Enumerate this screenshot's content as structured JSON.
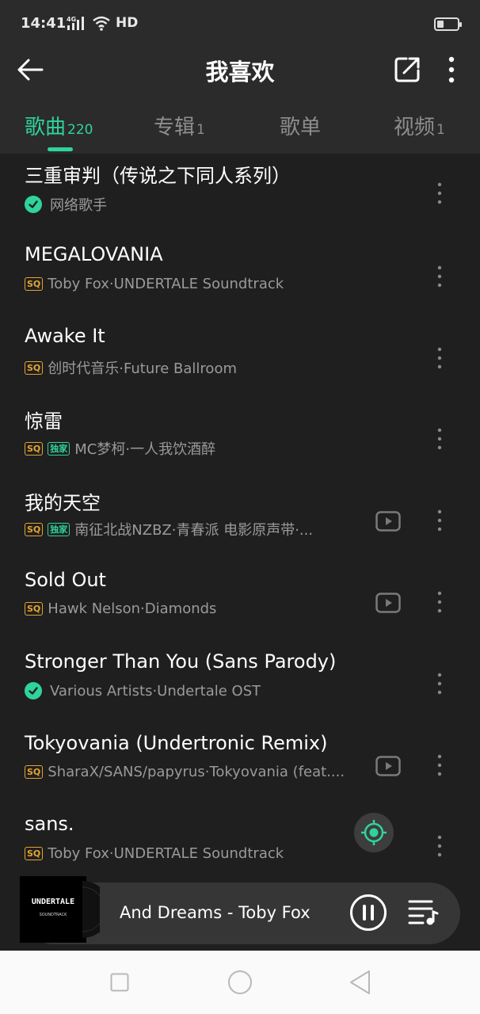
{
  "status": {
    "time": "14:41",
    "network": "4G",
    "hd": "HD"
  },
  "header": {
    "title": "我喜欢"
  },
  "tabs": [
    {
      "label": "歌曲",
      "count": "220",
      "active": true
    },
    {
      "label": "专辑",
      "count": "1"
    },
    {
      "label": "歌单",
      "count": ""
    },
    {
      "label": "视频",
      "count": "1"
    }
  ],
  "songs": [
    {
      "title": "三重审判（传说之下同人系列）",
      "meta": "网络歌手",
      "badges": [
        "check"
      ],
      "mv": false
    },
    {
      "title": "MEGALOVANIA",
      "meta": "Toby Fox·UNDERTALE Soundtrack",
      "badges": [
        "SQ"
      ],
      "mv": false
    },
    {
      "title": "Awake It",
      "meta": "创时代音乐·Future Ballroom",
      "badges": [
        "SQ"
      ],
      "mv": false
    },
    {
      "title": "惊雷",
      "meta": "MC梦柯·一人我饮酒醉",
      "badges": [
        "SQ",
        "独家"
      ],
      "mv": false
    },
    {
      "title": "我的天空",
      "meta": "南征北战NZBZ·青春派 电影原声带·...",
      "badges": [
        "SQ",
        "独家"
      ],
      "mv": true
    },
    {
      "title": "Sold Out",
      "meta": "Hawk Nelson·Diamonds",
      "badges": [
        "SQ"
      ],
      "mv": true
    },
    {
      "title": "Stronger Than You (Sans Parody)",
      "meta": "Various Artists·Undertale OST",
      "badges": [
        "check"
      ],
      "mv": false
    },
    {
      "title": "Tokyovania (Undertronic Remix)",
      "meta": "SharaX/SANS/papyrus·Tokyovania (feat....",
      "badges": [
        "SQ"
      ],
      "mv": true
    },
    {
      "title": "sans.",
      "meta": "Toby Fox·UNDERTALE Soundtrack",
      "badges": [
        "SQ"
      ],
      "mv": false
    }
  ],
  "player": {
    "now_playing": "And Dreams - Toby Fox",
    "cover_title": "UNDERTALE",
    "cover_subtitle": "SOUNDTRACK",
    "state": "playing"
  },
  "colors": {
    "accent": "#2fd49a",
    "sq": "#e3a431",
    "background": "#1f1f1f",
    "header": "#2b2b2b"
  },
  "icons": [
    "back-arrow-icon",
    "share-icon",
    "more-vertical-icon",
    "check-icon",
    "mv-play-icon",
    "locate-icon",
    "pause-icon",
    "playlist-icon",
    "nav-recent-icon",
    "nav-home-icon",
    "nav-back-icon"
  ]
}
